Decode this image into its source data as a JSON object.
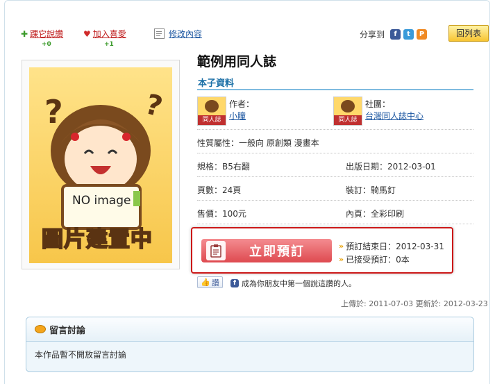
{
  "actions": {
    "recommend_label": "踝它說讚",
    "recommend_count": "+0",
    "favorite_label": "加入喜愛",
    "favorite_count": "+1",
    "edit_label": "修改內容"
  },
  "share": {
    "label": "分享到",
    "icons": [
      "facebook-icon",
      "twitter-icon",
      "plurk-icon"
    ]
  },
  "back_button": "回列表",
  "cover": {
    "caption": "NO image",
    "banner": "圖片建置中"
  },
  "book": {
    "title": "範例用同人誌",
    "section_title": "本子資料",
    "author_label": "作者：",
    "author_name": "小瞳",
    "circle_label": "社團：",
    "circle_name": "台灣同人誌中心",
    "attributes": "性質屬性：一般向 原創類 漫畫本",
    "format": "規格：B5右翻",
    "publish_date": "出版日期：2012-03-01",
    "pages": "頁數：24頁",
    "binding": "裝訂：騎馬釘",
    "price": "售價：100元",
    "inner": "內頁：全彩印刷"
  },
  "preorder": {
    "button_label": "立即預訂",
    "end_date": "預訂結束日：2012-03-31",
    "accepted": "已接受預訂：0本"
  },
  "social": {
    "like_label": "讚",
    "like_text": "成為你朋友中第一個說這讚的人。"
  },
  "dates": "上傳於: 2011-07-03 更新於: 2012-03-23",
  "comments": {
    "title": "留言討論",
    "message": "本作品暫不開放留言討論"
  },
  "colors": {
    "accent": "#1a6fa6",
    "preorder_border": "#cc1818",
    "preorder_button": "#de4a50",
    "back_button": "#f7c431"
  }
}
